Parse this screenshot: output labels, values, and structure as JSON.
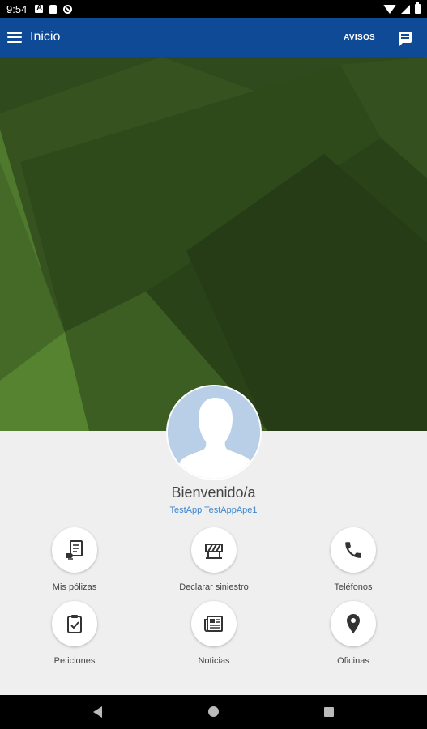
{
  "status_bar": {
    "time": "9:54"
  },
  "app_bar": {
    "title": "Inicio",
    "avisos_label": "AVISOS"
  },
  "profile": {
    "welcome": "Bienvenido/a",
    "username": "TestApp TestAppApe1"
  },
  "menu_items": [
    {
      "label": "Mis pólizas",
      "icon": "policy-document-icon"
    },
    {
      "label": "Declarar siniestro",
      "icon": "road-barrier-icon"
    },
    {
      "label": "Teléfonos",
      "icon": "phone-icon"
    },
    {
      "label": "Peticiones",
      "icon": "clipboard-check-icon"
    },
    {
      "label": "Noticias",
      "icon": "newspaper-icon"
    },
    {
      "label": "Oficinas",
      "icon": "location-pin-icon"
    }
  ],
  "colors": {
    "app_bar": "#0f4a96",
    "hero_green": "#3a5a22",
    "link_blue": "#3e86cf",
    "icon_dark": "#333333"
  }
}
